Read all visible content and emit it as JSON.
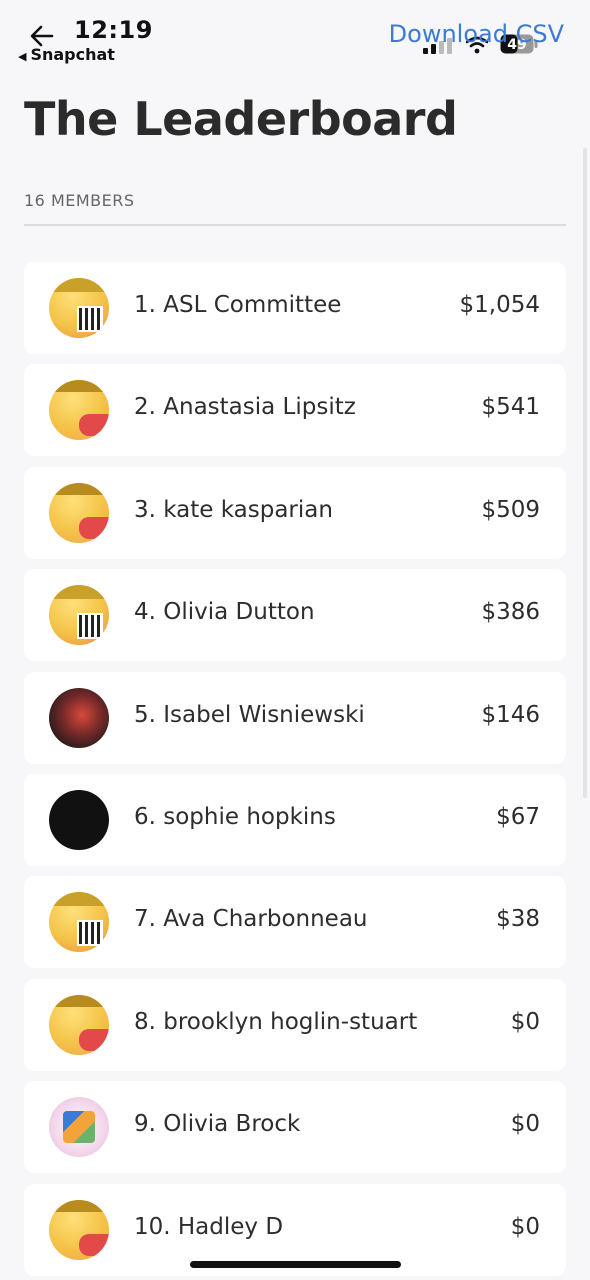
{
  "status_bar": {
    "time": "12:19",
    "back_app": "Snapchat",
    "battery": "49"
  },
  "header": {
    "download_link": "Download CSV",
    "title": "The Leaderboard",
    "member_count": "16 MEMBERS"
  },
  "leaderboard": [
    {
      "name": "1. ASL Committee",
      "amount": "$1,054",
      "avatar": "popcorn-flyer"
    },
    {
      "name": "2. Anastasia Lipsitz",
      "amount": "$541",
      "avatar": "popcorn-flyer"
    },
    {
      "name": "3. kate kasparian",
      "amount": "$509",
      "avatar": "popcorn-flyer"
    },
    {
      "name": "4. Olivia Dutton",
      "amount": "$386",
      "avatar": "popcorn-flyer"
    },
    {
      "name": "5. Isabel Wisniewski",
      "amount": "$146",
      "avatar": "theater-photo"
    },
    {
      "name": "6. sophie hopkins",
      "amount": "$67",
      "avatar": "black-circle"
    },
    {
      "name": "7. Ava Charbonneau",
      "amount": "$38",
      "avatar": "popcorn-flyer"
    },
    {
      "name": "8. brooklyn hoglin-stuart",
      "amount": "$0",
      "avatar": "popcorn-flyer"
    },
    {
      "name": "9. Olivia Brock",
      "amount": "$0",
      "avatar": "snack-bags"
    },
    {
      "name": "10. Hadley D",
      "amount": "$0",
      "avatar": "popcorn-flyer"
    }
  ],
  "colors": {
    "link": "#3b7ad8",
    "background": "#f7f7f9",
    "card": "#ffffff"
  }
}
